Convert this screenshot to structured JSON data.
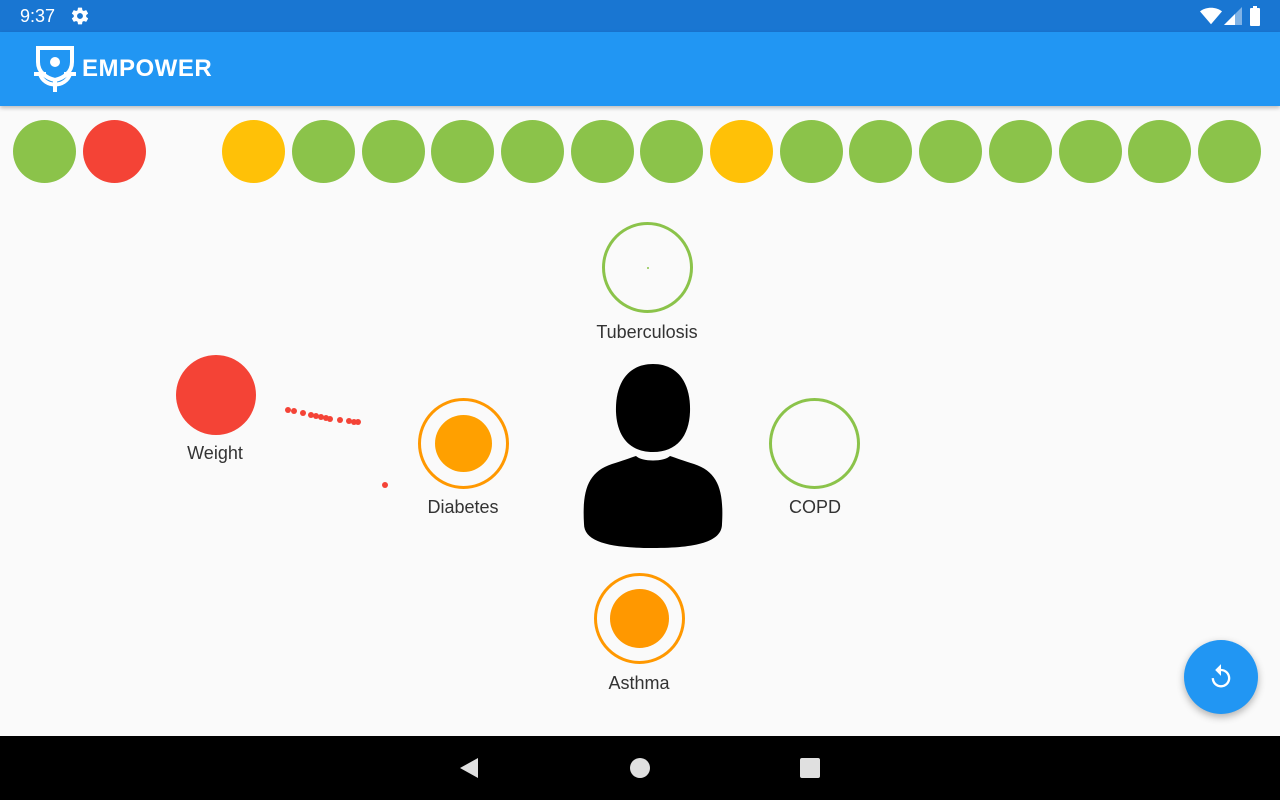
{
  "status_bar": {
    "time": "9:37",
    "icons": [
      "settings-icon",
      "wifi-icon",
      "cell-signal-icon",
      "battery-icon"
    ]
  },
  "app_bar": {
    "brand": "EMPOWER",
    "logo_icon": "empower-logo-icon",
    "color": "#2196f3"
  },
  "history": {
    "statuses": [
      "green",
      "red",
      "empty",
      "yellow",
      "green",
      "green",
      "green",
      "green",
      "green",
      "green",
      "yellow",
      "green",
      "green",
      "green",
      "green",
      "green",
      "green",
      "green"
    ],
    "colors": {
      "green": "#8bc34a",
      "red": "#f44336",
      "yellow": "#ffc107",
      "orange": "#ff9800"
    }
  },
  "conditions": [
    {
      "id": "tuberculosis",
      "label": "Tuberculosis",
      "status": "green"
    },
    {
      "id": "diabetes",
      "label": "Diabetes",
      "status": "orange"
    },
    {
      "id": "copd",
      "label": "COPD",
      "status": "green"
    },
    {
      "id": "asthma",
      "label": "Asthma",
      "status": "orange"
    }
  ],
  "weight": {
    "label": "Weight",
    "status": "red"
  },
  "center": {
    "icon": "person-icon"
  },
  "fab": {
    "icon": "refresh-icon"
  },
  "nav_bar": {
    "icons": [
      "back-icon",
      "home-icon",
      "recents-icon"
    ]
  }
}
